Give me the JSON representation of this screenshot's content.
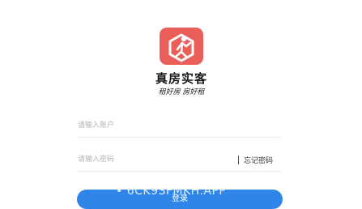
{
  "app": {
    "name": "真房实客",
    "slogan": "租好房  房好租",
    "logo_icon": "house-person-icon",
    "brand_color": "#ea5e59"
  },
  "form": {
    "account_placeholder": "请输入账户",
    "password_placeholder": "请输入密码",
    "forgot_password_label": "忘记密码",
    "login_label": "登录",
    "button_color": "#2f86e8"
  },
  "watermark": {
    "text": "• 6CK9SFMKH.APP"
  }
}
